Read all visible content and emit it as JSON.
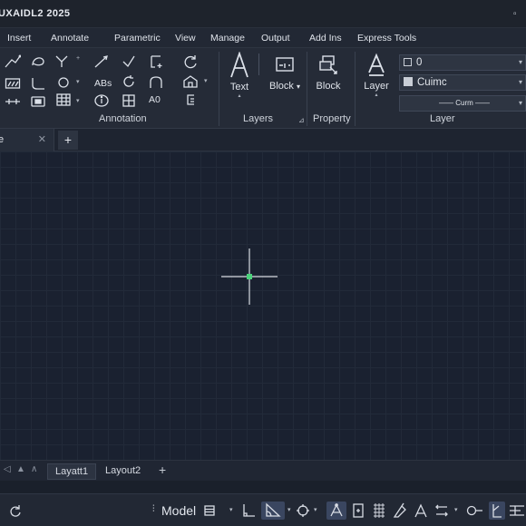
{
  "app": {
    "title": "UXAIDL2 2025",
    "window_control": "▫"
  },
  "menu": {
    "tabs": [
      "Insert",
      "Annotate",
      "Parametric",
      "View",
      "Manage",
      "Output",
      "Add Ins",
      "Express Tools"
    ]
  },
  "ribbon": {
    "annotation_panel_label": "Annotation",
    "abs_label": "ABs",
    "a0_label": "A0",
    "text_button_label": "Text",
    "block_button_label": "Block",
    "layers_panel_label": "Layers",
    "block_insert_label": "Block",
    "property_panel_label": "Property",
    "layer_button_label": "Layer",
    "layer_panel_label": "Layer",
    "layer_dropdown_value": "0",
    "color_dropdown_value": "Cuimc",
    "linetype_dropdown_value": "—— Curm ——"
  },
  "document_tabs": {
    "active_tab_name": "e",
    "close_symbol": "✕",
    "new_tab_symbol": "+"
  },
  "layout_tabs": {
    "tabs": [
      "Layatt1",
      "Layout2"
    ],
    "add_symbol": "+"
  },
  "status_bar": {
    "model_label": "Model",
    "active_tools": [
      "ortho",
      "polar",
      "osnap-track",
      "annotation-scale",
      "workspace"
    ]
  },
  "colors": {
    "background": "#1a2130",
    "ribbon": "#252b37",
    "accent_active": "#3a4660",
    "cursor_marker": "#4bd37b"
  }
}
